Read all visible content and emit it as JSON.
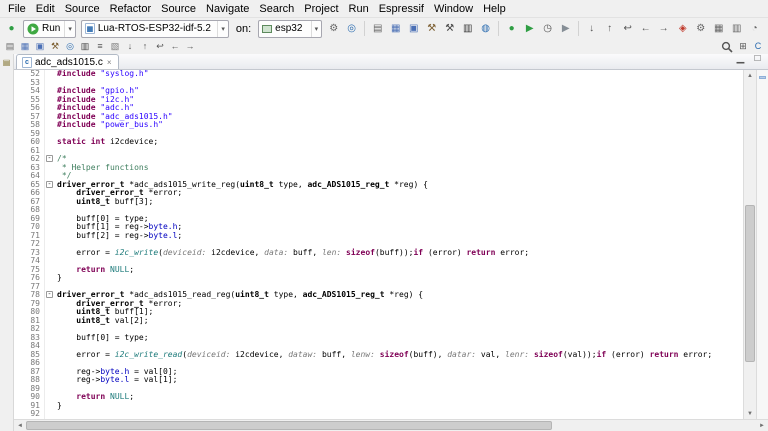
{
  "menubar": {
    "items": [
      "File",
      "Edit",
      "Source",
      "Refactor",
      "Source",
      "Navigate",
      "Search",
      "Project",
      "Run",
      "Espressif",
      "Window",
      "Help"
    ]
  },
  "glyphs": {
    "caret": "▾",
    "close": "×",
    "file_c": "c",
    "fold_minus": "-",
    "scroll_up": "▲",
    "scroll_down": "▼",
    "scroll_left": "◄",
    "scroll_right": "►"
  },
  "toolbar_main": {
    "leading": [
      {
        "name": "debug",
        "glyph": "●",
        "color": "#2f9e44"
      }
    ],
    "run": {
      "label": "Run"
    },
    "launch_config": {
      "value": "Lua-RTOS-ESP32-idf-5.2"
    },
    "on_label": "on:",
    "target": {
      "value": "esp32"
    },
    "after_target": [
      {
        "name": "launch-target-settings",
        "glyph": "⚙",
        "color": "#666666"
      },
      {
        "name": "edit-launch-config",
        "glyph": "◎",
        "color": "#2b6cb0"
      }
    ],
    "group_a": [
      {
        "name": "new-wizard",
        "glyph": "▤",
        "color": "#666666"
      },
      {
        "name": "save",
        "glyph": "▦",
        "color": "#4a6fb5"
      },
      {
        "name": "save-all",
        "glyph": "▣",
        "color": "#4a6fb5"
      },
      {
        "name": "build-active",
        "glyph": "⚒",
        "color": "#7a5c2e"
      },
      {
        "name": "build-all",
        "glyph": "⚒",
        "color": "#444444"
      },
      {
        "name": "open-terminal",
        "glyph": "▥",
        "color": "#333333"
      },
      {
        "name": "search-dialog",
        "glyph": "◍",
        "color": "#2b6cb0"
      }
    ],
    "group_b": [
      {
        "name": "debug-mode",
        "glyph": "●",
        "color": "#2f9e44"
      },
      {
        "name": "run-history",
        "glyph": "▶",
        "color": "#2f9e44"
      },
      {
        "name": "profile",
        "glyph": "◷",
        "color": "#555555"
      },
      {
        "name": "external-tools",
        "glyph": "▶",
        "color": "#868e96"
      }
    ],
    "group_c": [
      {
        "name": "next-marker",
        "glyph": "↓",
        "color": "#555555"
      },
      {
        "name": "previous-marker",
        "glyph": "↑",
        "color": "#555555"
      },
      {
        "name": "last-edit-location",
        "glyph": "↩",
        "color": "#555555"
      },
      {
        "name": "back",
        "glyph": "←",
        "color": "#555555"
      },
      {
        "name": "forward",
        "glyph": "→",
        "color": "#555555"
      }
    ],
    "right": [
      {
        "name": "espressif-tools",
        "glyph": "◈",
        "color": "#c0392b"
      },
      {
        "name": "sdk-configuration",
        "glyph": "⚙",
        "color": "#666666"
      },
      {
        "name": "partition-table",
        "glyph": "▦",
        "color": "#666666"
      },
      {
        "name": "serial-monitor",
        "glyph": "▥",
        "color": "#666666"
      },
      {
        "name": "heap-tracing",
        "glyph": "◔",
        "color": "#666666"
      },
      {
        "name": "help",
        "glyph": "?",
        "color": "#2b6cb0"
      }
    ]
  },
  "toolbar_sub": {
    "left": [
      {
        "name": "new-file-dropdown",
        "glyph": "▤",
        "color": "#666666"
      },
      {
        "name": "save-sub",
        "glyph": "▦",
        "color": "#4a6fb5"
      },
      {
        "name": "save-all-sub",
        "glyph": "▣",
        "color": "#4a6fb5"
      },
      {
        "name": "build-sub",
        "glyph": "⚒",
        "color": "#7a5c2e"
      },
      {
        "name": "new-connection",
        "glyph": "◎",
        "color": "#2b6cb0"
      },
      {
        "name": "console",
        "glyph": "▥",
        "color": "#444444"
      },
      {
        "name": "toggle-breadcrumb",
        "glyph": "≡",
        "color": "#555555"
      },
      {
        "name": "mark-occurrences",
        "glyph": "▧",
        "color": "#777777"
      },
      {
        "name": "next-annotation",
        "glyph": "↓",
        "color": "#555555"
      },
      {
        "name": "previous-annotation",
        "glyph": "↑",
        "color": "#555555"
      },
      {
        "name": "last-edit-sub",
        "glyph": "↩",
        "color": "#555555"
      },
      {
        "name": "back-sub",
        "glyph": "←",
        "color": "#555555"
      },
      {
        "name": "forward-sub",
        "glyph": "→",
        "color": "#555555"
      }
    ],
    "right_perspective": [
      {
        "name": "open-perspective",
        "glyph": "⊞",
        "color": "#555555"
      },
      {
        "name": "cpp-perspective",
        "glyph": "C",
        "color": "#2b6cb0"
      }
    ]
  },
  "leftstrip": {
    "icons": [
      {
        "name": "minimized-view",
        "glyph": "▤",
        "color": "#7a6a20"
      }
    ]
  },
  "tabrow": {
    "window_icons": [
      {
        "name": "minimize-editor",
        "glyph": "▁",
        "color": "#555555"
      },
      {
        "name": "maximize-editor",
        "glyph": "□",
        "color": "#555555"
      }
    ]
  },
  "editor": {
    "tab": "adc_ads1015.c",
    "lines": [
      {
        "n": 52,
        "t": [
          [
            "dir",
            "#include"
          ],
          [
            "p",
            " "
          ],
          [
            "str",
            "\"syslog.h\""
          ]
        ]
      },
      {
        "n": 53,
        "t": []
      },
      {
        "n": 54,
        "t": [
          [
            "dir",
            "#include"
          ],
          [
            "p",
            " "
          ],
          [
            "str",
            "\"gpio.h\""
          ]
        ]
      },
      {
        "n": 55,
        "t": [
          [
            "dir",
            "#include"
          ],
          [
            "p",
            " "
          ],
          [
            "str",
            "\"i2c.h\""
          ]
        ]
      },
      {
        "n": 56,
        "t": [
          [
            "dir",
            "#include"
          ],
          [
            "p",
            " "
          ],
          [
            "str",
            "\"adc.h\""
          ]
        ]
      },
      {
        "n": 57,
        "t": [
          [
            "dir",
            "#include"
          ],
          [
            "p",
            " "
          ],
          [
            "str",
            "\"adc_ads1015.h\""
          ]
        ]
      },
      {
        "n": 58,
        "t": [
          [
            "dir",
            "#include"
          ],
          [
            "p",
            " "
          ],
          [
            "str",
            "\"power_bus.h\""
          ]
        ]
      },
      {
        "n": 59,
        "t": []
      },
      {
        "n": 60,
        "t": [
          [
            "kw",
            "static"
          ],
          [
            "p",
            " "
          ],
          [
            "kw",
            "int"
          ],
          [
            "p",
            " i2cdevice;"
          ]
        ]
      },
      {
        "n": 61,
        "t": []
      },
      {
        "n": 62,
        "f": 1,
        "t": [
          [
            "cmt",
            "/*"
          ]
        ]
      },
      {
        "n": 63,
        "t": [
          [
            "cmt",
            " * Helper functions"
          ]
        ]
      },
      {
        "n": 64,
        "t": [
          [
            "cmt",
            " */"
          ]
        ]
      },
      {
        "n": 65,
        "f": 1,
        "t": [
          [
            "ty",
            "driver_error_t"
          ],
          [
            "p",
            " *adc_ads1015_write_reg("
          ],
          [
            "ty",
            "uint8_t"
          ],
          [
            "p",
            " type, "
          ],
          [
            "ty",
            "adc_ADS1015_reg_t"
          ],
          [
            "p",
            " *reg) {"
          ]
        ]
      },
      {
        "n": 66,
        "t": [
          [
            "p",
            "    "
          ],
          [
            "ty",
            "driver_error_t"
          ],
          [
            "p",
            " *error;"
          ]
        ]
      },
      {
        "n": 67,
        "t": [
          [
            "p",
            "    "
          ],
          [
            "ty",
            "uint8_t"
          ],
          [
            "p",
            " buff[3];"
          ]
        ]
      },
      {
        "n": 68,
        "t": []
      },
      {
        "n": 69,
        "t": [
          [
            "p",
            "    buff[0] = type;"
          ]
        ]
      },
      {
        "n": 70,
        "t": [
          [
            "p",
            "    buff[1] = reg->"
          ],
          [
            "fd",
            "byte.h"
          ],
          [
            "p",
            ";"
          ]
        ]
      },
      {
        "n": 71,
        "t": [
          [
            "p",
            "    buff[2] = reg->"
          ],
          [
            "fd",
            "byte.l"
          ],
          [
            "p",
            ";"
          ]
        ]
      },
      {
        "n": 72,
        "t": []
      },
      {
        "n": 73,
        "t": [
          [
            "p",
            "    error = "
          ],
          [
            "fn",
            "i2c_write"
          ],
          [
            "p",
            "("
          ],
          [
            "pr",
            "deviceid:"
          ],
          [
            "p",
            " i2cdevice, "
          ],
          [
            "pr",
            "data:"
          ],
          [
            "p",
            " buff, "
          ],
          [
            "pr",
            "len:"
          ],
          [
            "p",
            " "
          ],
          [
            "kw",
            "sizeof"
          ],
          [
            "p",
            "(buff));"
          ],
          [
            "kw",
            "if"
          ],
          [
            "p",
            " (error) "
          ],
          [
            "kw",
            "return"
          ],
          [
            "p",
            " error;"
          ]
        ]
      },
      {
        "n": 74,
        "t": []
      },
      {
        "n": 75,
        "t": [
          [
            "p",
            "    "
          ],
          [
            "kw",
            "return"
          ],
          [
            "p",
            " "
          ],
          [
            "mc",
            "NULL"
          ],
          [
            "p",
            ";"
          ]
        ]
      },
      {
        "n": 76,
        "t": [
          [
            "p",
            "}"
          ]
        ]
      },
      {
        "n": 77,
        "t": []
      },
      {
        "n": 78,
        "f": 1,
        "t": [
          [
            "ty",
            "driver_error_t"
          ],
          [
            "p",
            " *adc_ads1015_read_reg("
          ],
          [
            "ty",
            "uint8_t"
          ],
          [
            "p",
            " type, "
          ],
          [
            "ty",
            "adc_ADS1015_reg_t"
          ],
          [
            "p",
            " *reg) {"
          ]
        ]
      },
      {
        "n": 79,
        "t": [
          [
            "p",
            "    "
          ],
          [
            "ty",
            "driver_error_t"
          ],
          [
            "p",
            " *error;"
          ]
        ]
      },
      {
        "n": 80,
        "t": [
          [
            "p",
            "    "
          ],
          [
            "ty",
            "uint8_t"
          ],
          [
            "p",
            " buff[1];"
          ]
        ]
      },
      {
        "n": 81,
        "t": [
          [
            "p",
            "    "
          ],
          [
            "ty",
            "uint8_t"
          ],
          [
            "p",
            " val[2];"
          ]
        ]
      },
      {
        "n": 82,
        "t": []
      },
      {
        "n": 83,
        "t": [
          [
            "p",
            "    buff[0] = type;"
          ]
        ]
      },
      {
        "n": 84,
        "t": []
      },
      {
        "n": 85,
        "t": [
          [
            "p",
            "    error = "
          ],
          [
            "fn",
            "i2c_write_read"
          ],
          [
            "p",
            "("
          ],
          [
            "pr",
            "deviceid:"
          ],
          [
            "p",
            " i2cdevice, "
          ],
          [
            "pr",
            "dataw:"
          ],
          [
            "p",
            " buff, "
          ],
          [
            "pr",
            "lenw:"
          ],
          [
            "p",
            " "
          ],
          [
            "kw",
            "sizeof"
          ],
          [
            "p",
            "(buff), "
          ],
          [
            "pr",
            "datar:"
          ],
          [
            "p",
            " val, "
          ],
          [
            "pr",
            "lenr:"
          ],
          [
            "p",
            " "
          ],
          [
            "kw",
            "sizeof"
          ],
          [
            "p",
            "(val));"
          ],
          [
            "kw",
            "if"
          ],
          [
            "p",
            " (error) "
          ],
          [
            "kw",
            "return"
          ],
          [
            "p",
            " error;"
          ]
        ]
      },
      {
        "n": 86,
        "t": []
      },
      {
        "n": 87,
        "t": [
          [
            "p",
            "    reg->"
          ],
          [
            "fd",
            "byte.h"
          ],
          [
            "p",
            " = val[0];"
          ]
        ]
      },
      {
        "n": 88,
        "t": [
          [
            "p",
            "    reg->"
          ],
          [
            "fd",
            "byte.l"
          ],
          [
            "p",
            " = val[1];"
          ]
        ]
      },
      {
        "n": 89,
        "t": []
      },
      {
        "n": 90,
        "t": [
          [
            "p",
            "    "
          ],
          [
            "kw",
            "return"
          ],
          [
            "p",
            " "
          ],
          [
            "mc",
            "NULL"
          ],
          [
            "p",
            ";"
          ]
        ]
      },
      {
        "n": 91,
        "t": [
          [
            "p",
            "}"
          ]
        ]
      },
      {
        "n": 92,
        "t": []
      }
    ]
  }
}
